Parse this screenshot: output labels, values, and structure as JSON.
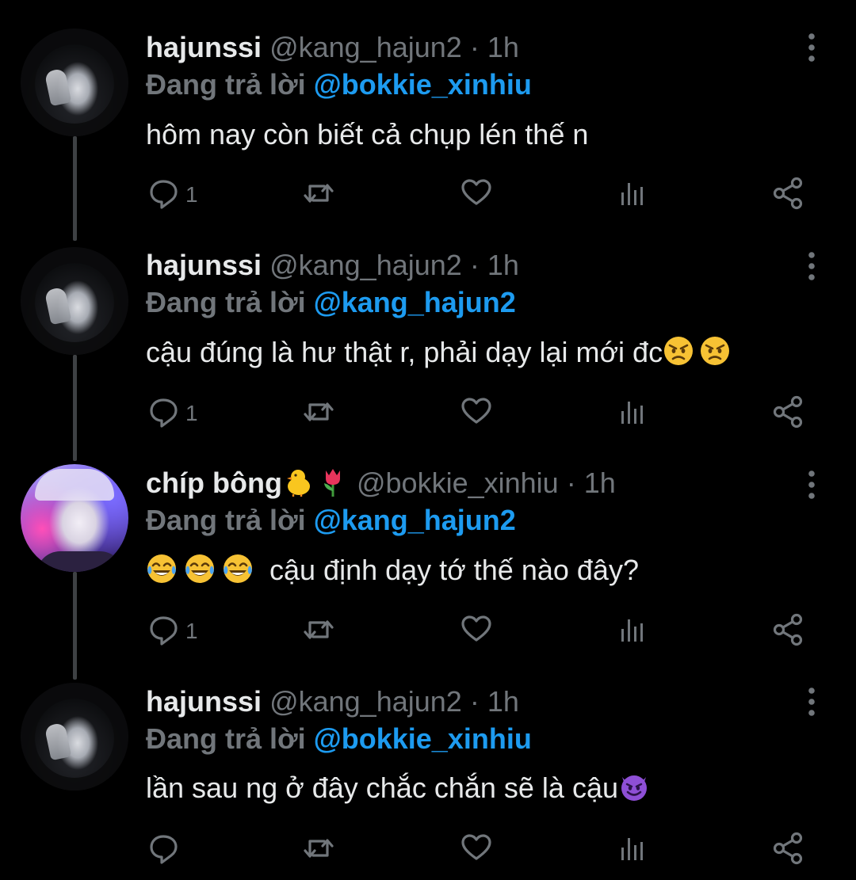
{
  "colors": {
    "background": "#000000",
    "text": "#e7e9ea",
    "muted": "#71767b",
    "mention": "#1d9bf0",
    "thread_line": "#3e4144"
  },
  "tweets": [
    {
      "display_name": "hajunssi",
      "handle": "@kang_hajun2",
      "separator": "·",
      "time": "1h",
      "reply_label": "Đang trả lời",
      "reply_to": "@bokkie_xinhiu",
      "text": "hôm nay còn biết cả chụp lén thế n",
      "reply_count": "1",
      "avatar": "dark-hooded-avatar"
    },
    {
      "display_name": "hajunssi",
      "handle": "@kang_hajun2",
      "separator": "·",
      "time": "1h",
      "reply_label": "Đang trả lời",
      "reply_to": "@kang_hajun2",
      "text": "cậu đúng là hư thật r, phải dạy lại mới đc",
      "trailing_emojis": [
        "angry-face-emoji",
        "angry-face-emoji"
      ],
      "reply_count": "1",
      "avatar": "dark-hooded-avatar"
    },
    {
      "display_name": "chíp bông",
      "name_emojis": [
        "baby-chick-emoji",
        "tulip-emoji"
      ],
      "handle": "@bokkie_xinhiu",
      "separator": "·",
      "time": "1h",
      "reply_label": "Đang trả lời",
      "reply_to": "@kang_hajun2",
      "leading_emojis": [
        "tears-of-joy-emoji",
        "tears-of-joy-emoji",
        "tears-of-joy-emoji"
      ],
      "text": "cậu định dạy tớ thế nào đây?",
      "reply_count": "1",
      "avatar": "face-mask-avatar"
    },
    {
      "display_name": "hajunssi",
      "handle": "@kang_hajun2",
      "separator": "·",
      "time": "1h",
      "reply_label": "Đang trả lời",
      "reply_to": "@bokkie_xinhiu",
      "text": "lần sau ng ở đây chắc chắn sẽ là cậu",
      "trailing_emojis": [
        "smiling-devil-emoji"
      ],
      "reply_count": "",
      "avatar": "dark-hooded-avatar"
    }
  ],
  "action_icons": [
    "reply-icon",
    "retweet-icon",
    "like-icon",
    "views-icon",
    "share-icon"
  ],
  "more_icon": "more-vertical-icon"
}
